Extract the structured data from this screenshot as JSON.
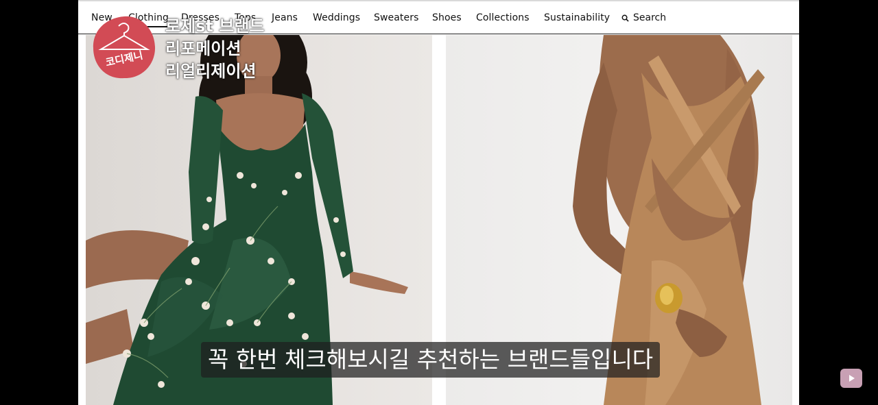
{
  "nav": {
    "items": [
      {
        "label": "New"
      },
      {
        "label": "Clothing"
      },
      {
        "label": "Dresses"
      },
      {
        "label": "Tops"
      },
      {
        "label": "Jeans"
      },
      {
        "label": "Weddings"
      },
      {
        "label": "Sweaters"
      },
      {
        "label": "Shoes"
      },
      {
        "label": "Collections"
      },
      {
        "label": "Sustainability"
      }
    ],
    "search_label": "Search"
  },
  "logo": {
    "text": "코디제니"
  },
  "overlay": {
    "lines": [
      "로제st 브랜드",
      "리포메이션",
      "리얼리제이션"
    ]
  },
  "subtitle": "꼭 한번 체크해보시길 추천하는 브랜드들입니다",
  "colors": {
    "background": "#000000",
    "nav_bg": "#ffffff",
    "logo_red": "#d24b55",
    "dress_green": "#1f4a32",
    "dress_satin": "#b8875a"
  },
  "icons": {
    "search": "search-icon",
    "play": "play-icon"
  }
}
